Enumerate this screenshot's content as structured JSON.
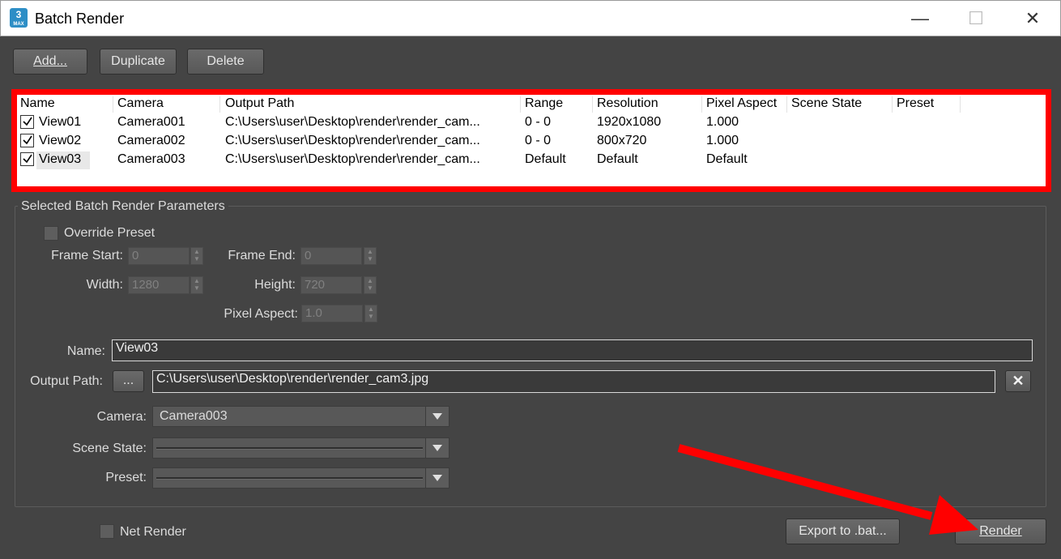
{
  "window": {
    "title": "Batch Render",
    "app_icon": {
      "main": "3",
      "sub": "MAX"
    },
    "controls": [
      "minimize-icon",
      "maximize-icon",
      "close-icon"
    ]
  },
  "toolbar": {
    "add": "Add...",
    "duplicate": "Duplicate",
    "delete": "Delete"
  },
  "list": {
    "columns": [
      "Name",
      "Camera",
      "Output Path",
      "Range",
      "Resolution",
      "Pixel Aspect",
      "Scene State",
      "Preset"
    ],
    "rows": [
      {
        "checked": true,
        "name": "View01",
        "camera": "Camera001",
        "output": "C:\\Users\\user\\Desktop\\render\\render_cam...",
        "range": "0 - 0",
        "resolution": "1920x1080",
        "aspect": "1.000",
        "scene_state": "",
        "preset": ""
      },
      {
        "checked": true,
        "name": "View02",
        "camera": "Camera002",
        "output": "C:\\Users\\user\\Desktop\\render\\render_cam...",
        "range": "0 - 0",
        "resolution": "800x720",
        "aspect": "1.000",
        "scene_state": "",
        "preset": ""
      },
      {
        "checked": true,
        "name": "View03",
        "camera": "Camera003",
        "output": "C:\\Users\\user\\Desktop\\render\\render_cam...",
        "range": "Default",
        "resolution": "Default",
        "aspect": "Default",
        "scene_state": "",
        "preset": ""
      }
    ]
  },
  "params": {
    "group_title": "Selected Batch Render Parameters",
    "override_preset": "Override Preset",
    "frame_start_label": "Frame Start:",
    "frame_start": "0",
    "frame_end_label": "Frame End:",
    "frame_end": "0",
    "width_label": "Width:",
    "width": "1280",
    "height_label": "Height:",
    "height": "720",
    "pixel_aspect_label": "Pixel Aspect:",
    "pixel_aspect": "1.0",
    "name_label": "Name:",
    "name": "View03",
    "output_path_label": "Output Path:",
    "browse": "...",
    "output_path": "C:\\Users\\user\\Desktop\\render\\render_cam3.jpg",
    "camera_label": "Camera:",
    "camera": "Camera003",
    "scene_state_label": "Scene State:",
    "preset_label": "Preset:"
  },
  "footer": {
    "net_render": "Net Render",
    "export": "Export to .bat...",
    "render": "Render"
  },
  "annotations": {
    "highlight_color": "#ff0000"
  }
}
